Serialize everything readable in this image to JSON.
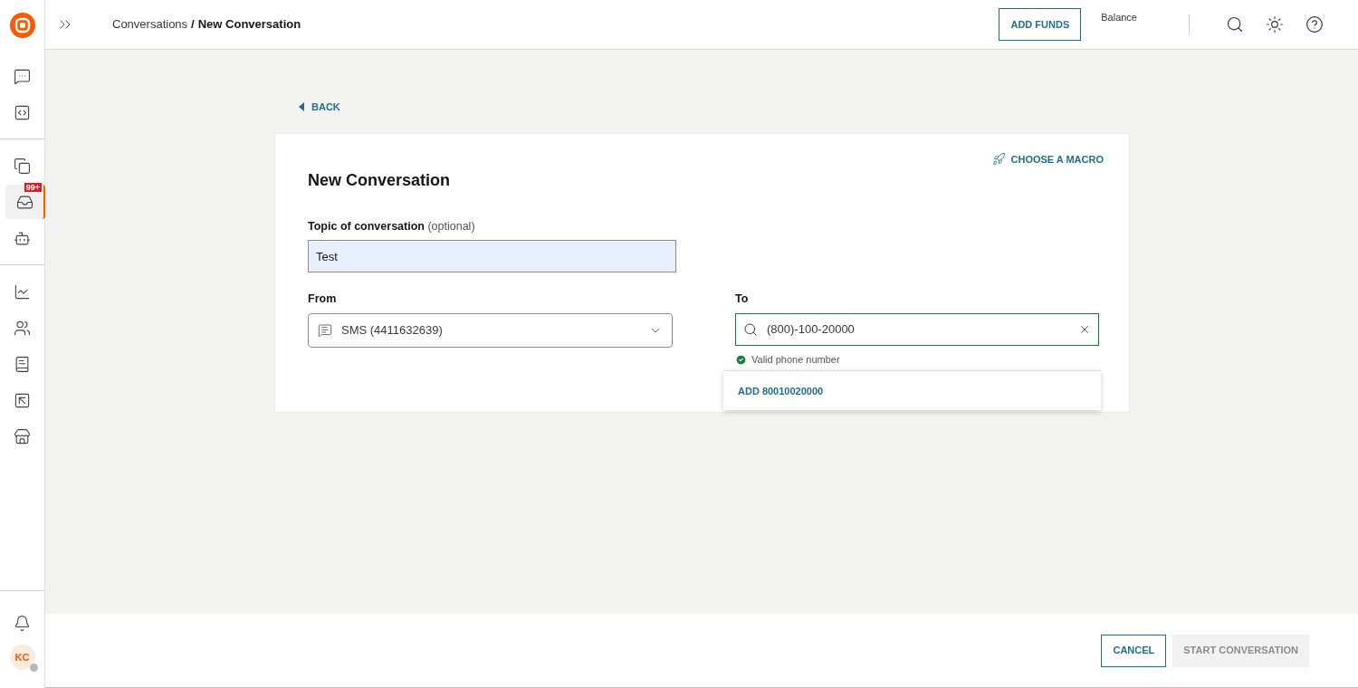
{
  "header": {
    "breadcrumb": [
      {
        "label": "Conversations",
        "current": false
      },
      {
        "label": "New Conversation",
        "current": true
      }
    ],
    "separator": "/",
    "add_funds": "ADD FUNDS",
    "balance_label": "Balance"
  },
  "sidebar": {
    "groups": [
      [
        {
          "selected": false
        },
        {
          "selected": false
        }
      ],
      [
        {
          "selected": false
        },
        {
          "selected": true,
          "badge": "99+"
        },
        {
          "selected": false
        }
      ],
      [
        {
          "selected": false
        },
        {
          "selected": false
        },
        {
          "selected": false
        },
        {
          "selected": false
        },
        {
          "selected": false
        }
      ]
    ],
    "avatar": {
      "initials": "KC",
      "online": false
    }
  },
  "back": "BACK",
  "form": {
    "title": "New Conversation",
    "macro": "CHOOSE A MACRO",
    "topic": {
      "label": "Topic of conversation",
      "hint": "(optional)",
      "value": "Test"
    },
    "from": {
      "label": "From",
      "value": "SMS (4411632639)"
    },
    "to": {
      "label": "To",
      "value": "(800)-100-20000",
      "valid": true,
      "message": "Valid phone number",
      "suggestion": "ADD 80010020000"
    }
  },
  "footer": {
    "buttons": [
      {
        "label": "CANCEL",
        "disabled": false
      },
      {
        "label": "START CONVERSATION",
        "disabled": true
      }
    ]
  }
}
